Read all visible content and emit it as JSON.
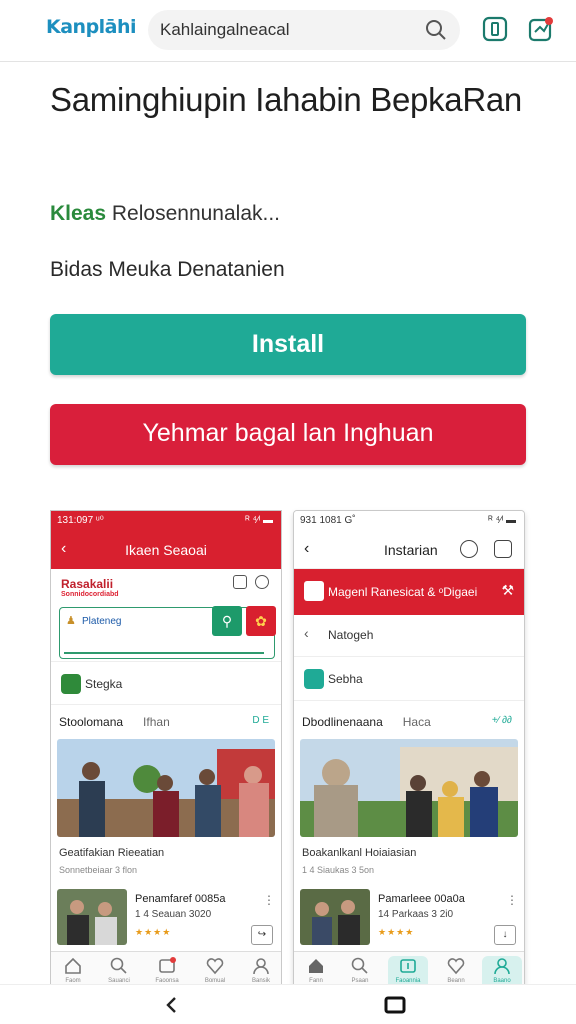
{
  "header": {
    "logo": "Kanplāhi",
    "search_value": "Kahlaingalneacal"
  },
  "app": {
    "title": "Saminghiupin Iahabin BepkaRan",
    "developer_accent": "Kleas",
    "developer_rest": "Relosennunalak...",
    "meta_line": "Bidas Meuka Denatanien",
    "install_label": "Install",
    "secondary_label": "Yehmar bagal lan Inghuan"
  },
  "screens": {
    "left": {
      "status_time": "131:097 ᵘ⁰",
      "status_right": "ᴿ ⁴⁄ᴵ ▬",
      "title": "Ikaen Seaoai",
      "brand": "Rasakalii",
      "brand_sub": "Sonnidocordiabd",
      "promo_text": "Plateneg",
      "row_label": "Stegka",
      "section_title": "Stoolomana",
      "section_sub": "Ifhan",
      "section_tag": "D  E",
      "news_title": "Geatifakian Rieeatian",
      "news_sub": "Sonnetbeiaar 3 flon",
      "item_title": "Penamfaref 0085a",
      "item_sub": "1 4 Seauan 3020",
      "stars": "★★★★",
      "nav": [
        "Faom",
        "Sauanci",
        "Faoonsa",
        "Bomual",
        "Bansik"
      ]
    },
    "right": {
      "status_time": "931 1081 G˚",
      "status_right": "ᴿ ⁴⁄ᴵ ▬",
      "title": "Instarian",
      "bar_text": "Magenl Ranesicat & ᵒDigaei",
      "row1_label": "Natogeh",
      "row2_label": "Sebha",
      "section_title": "Dbodlinenaana",
      "section_sub": "Haca",
      "section_tag": "+∕ ∂∂",
      "news_title": "Boakanlkanl Hoiaiasian",
      "news_sub": "1 4 Siaukas 3 5on",
      "item_title": "Pamarleee 00a0a",
      "item_sub": "14 Parkaas 3 2i0",
      "stars": "★★★★",
      "nav": [
        "Fann",
        "Psaan",
        "Faoannia",
        "Beann",
        "Baano"
      ]
    }
  },
  "colors": {
    "install": "#1faa96",
    "secondary": "#d91f3b",
    "brand": "#1d8fbf"
  }
}
